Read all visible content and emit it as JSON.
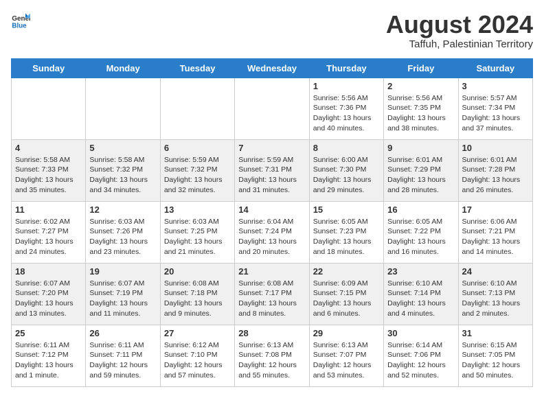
{
  "header": {
    "logo_general": "General",
    "logo_blue": "Blue",
    "month_year": "August 2024",
    "location": "Taffuh, Palestinian Territory"
  },
  "days_of_week": [
    "Sunday",
    "Monday",
    "Tuesday",
    "Wednesday",
    "Thursday",
    "Friday",
    "Saturday"
  ],
  "weeks": [
    [
      {
        "day": "",
        "info": ""
      },
      {
        "day": "",
        "info": ""
      },
      {
        "day": "",
        "info": ""
      },
      {
        "day": "",
        "info": ""
      },
      {
        "day": "1",
        "info": "Sunrise: 5:56 AM\nSunset: 7:36 PM\nDaylight: 13 hours\nand 40 minutes."
      },
      {
        "day": "2",
        "info": "Sunrise: 5:56 AM\nSunset: 7:35 PM\nDaylight: 13 hours\nand 38 minutes."
      },
      {
        "day": "3",
        "info": "Sunrise: 5:57 AM\nSunset: 7:34 PM\nDaylight: 13 hours\nand 37 minutes."
      }
    ],
    [
      {
        "day": "4",
        "info": "Sunrise: 5:58 AM\nSunset: 7:33 PM\nDaylight: 13 hours\nand 35 minutes."
      },
      {
        "day": "5",
        "info": "Sunrise: 5:58 AM\nSunset: 7:32 PM\nDaylight: 13 hours\nand 34 minutes."
      },
      {
        "day": "6",
        "info": "Sunrise: 5:59 AM\nSunset: 7:32 PM\nDaylight: 13 hours\nand 32 minutes."
      },
      {
        "day": "7",
        "info": "Sunrise: 5:59 AM\nSunset: 7:31 PM\nDaylight: 13 hours\nand 31 minutes."
      },
      {
        "day": "8",
        "info": "Sunrise: 6:00 AM\nSunset: 7:30 PM\nDaylight: 13 hours\nand 29 minutes."
      },
      {
        "day": "9",
        "info": "Sunrise: 6:01 AM\nSunset: 7:29 PM\nDaylight: 13 hours\nand 28 minutes."
      },
      {
        "day": "10",
        "info": "Sunrise: 6:01 AM\nSunset: 7:28 PM\nDaylight: 13 hours\nand 26 minutes."
      }
    ],
    [
      {
        "day": "11",
        "info": "Sunrise: 6:02 AM\nSunset: 7:27 PM\nDaylight: 13 hours\nand 24 minutes."
      },
      {
        "day": "12",
        "info": "Sunrise: 6:03 AM\nSunset: 7:26 PM\nDaylight: 13 hours\nand 23 minutes."
      },
      {
        "day": "13",
        "info": "Sunrise: 6:03 AM\nSunset: 7:25 PM\nDaylight: 13 hours\nand 21 minutes."
      },
      {
        "day": "14",
        "info": "Sunrise: 6:04 AM\nSunset: 7:24 PM\nDaylight: 13 hours\nand 20 minutes."
      },
      {
        "day": "15",
        "info": "Sunrise: 6:05 AM\nSunset: 7:23 PM\nDaylight: 13 hours\nand 18 minutes."
      },
      {
        "day": "16",
        "info": "Sunrise: 6:05 AM\nSunset: 7:22 PM\nDaylight: 13 hours\nand 16 minutes."
      },
      {
        "day": "17",
        "info": "Sunrise: 6:06 AM\nSunset: 7:21 PM\nDaylight: 13 hours\nand 14 minutes."
      }
    ],
    [
      {
        "day": "18",
        "info": "Sunrise: 6:07 AM\nSunset: 7:20 PM\nDaylight: 13 hours\nand 13 minutes."
      },
      {
        "day": "19",
        "info": "Sunrise: 6:07 AM\nSunset: 7:19 PM\nDaylight: 13 hours\nand 11 minutes."
      },
      {
        "day": "20",
        "info": "Sunrise: 6:08 AM\nSunset: 7:18 PM\nDaylight: 13 hours\nand 9 minutes."
      },
      {
        "day": "21",
        "info": "Sunrise: 6:08 AM\nSunset: 7:17 PM\nDaylight: 13 hours\nand 8 minutes."
      },
      {
        "day": "22",
        "info": "Sunrise: 6:09 AM\nSunset: 7:15 PM\nDaylight: 13 hours\nand 6 minutes."
      },
      {
        "day": "23",
        "info": "Sunrise: 6:10 AM\nSunset: 7:14 PM\nDaylight: 13 hours\nand 4 minutes."
      },
      {
        "day": "24",
        "info": "Sunrise: 6:10 AM\nSunset: 7:13 PM\nDaylight: 13 hours\nand 2 minutes."
      }
    ],
    [
      {
        "day": "25",
        "info": "Sunrise: 6:11 AM\nSunset: 7:12 PM\nDaylight: 13 hours\nand 1 minute."
      },
      {
        "day": "26",
        "info": "Sunrise: 6:11 AM\nSunset: 7:11 PM\nDaylight: 12 hours\nand 59 minutes."
      },
      {
        "day": "27",
        "info": "Sunrise: 6:12 AM\nSunset: 7:10 PM\nDaylight: 12 hours\nand 57 minutes."
      },
      {
        "day": "28",
        "info": "Sunrise: 6:13 AM\nSunset: 7:08 PM\nDaylight: 12 hours\nand 55 minutes."
      },
      {
        "day": "29",
        "info": "Sunrise: 6:13 AM\nSunset: 7:07 PM\nDaylight: 12 hours\nand 53 minutes."
      },
      {
        "day": "30",
        "info": "Sunrise: 6:14 AM\nSunset: 7:06 PM\nDaylight: 12 hours\nand 52 minutes."
      },
      {
        "day": "31",
        "info": "Sunrise: 6:15 AM\nSunset: 7:05 PM\nDaylight: 12 hours\nand 50 minutes."
      }
    ]
  ]
}
